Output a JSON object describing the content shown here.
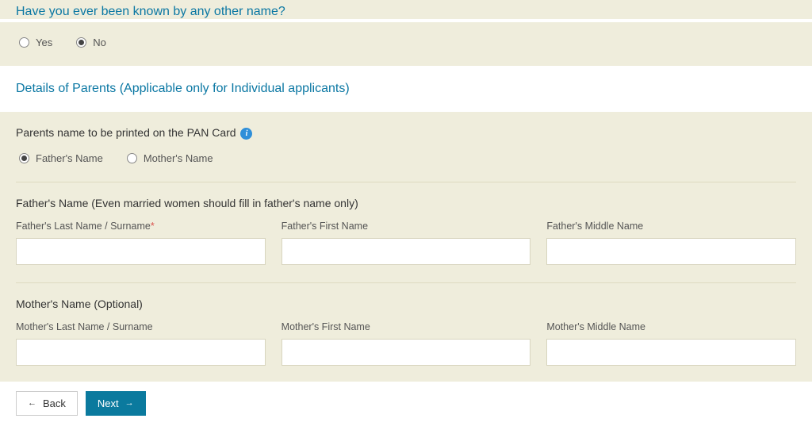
{
  "otherName": {
    "question": "Have you ever been known by any other name?",
    "options": {
      "yes": "Yes",
      "no": "No"
    },
    "selected": "no"
  },
  "parents": {
    "heading": "Details of Parents (Applicable only for Individual applicants)",
    "printLabel": "Parents name to be printed on the PAN Card",
    "options": {
      "father": "Father's Name",
      "mother": "Mother's Name"
    },
    "selected": "father",
    "father": {
      "heading": "Father's Name (Even married women should fill in father's name only)",
      "last": {
        "label": "Father's Last Name / Surname",
        "value": ""
      },
      "first": {
        "label": "Father's First Name",
        "value": ""
      },
      "middle": {
        "label": "Father's Middle Name",
        "value": ""
      }
    },
    "mother": {
      "heading": "Mother's Name (Optional)",
      "last": {
        "label": "Mother's Last Name / Surname",
        "value": ""
      },
      "first": {
        "label": "Mother's First Name",
        "value": ""
      },
      "middle": {
        "label": "Mother's Middle Name",
        "value": ""
      }
    }
  },
  "buttons": {
    "back": "Back",
    "next": "Next"
  },
  "icons": {
    "info": "i",
    "leftArrow": "←",
    "rightArrow": "→"
  }
}
